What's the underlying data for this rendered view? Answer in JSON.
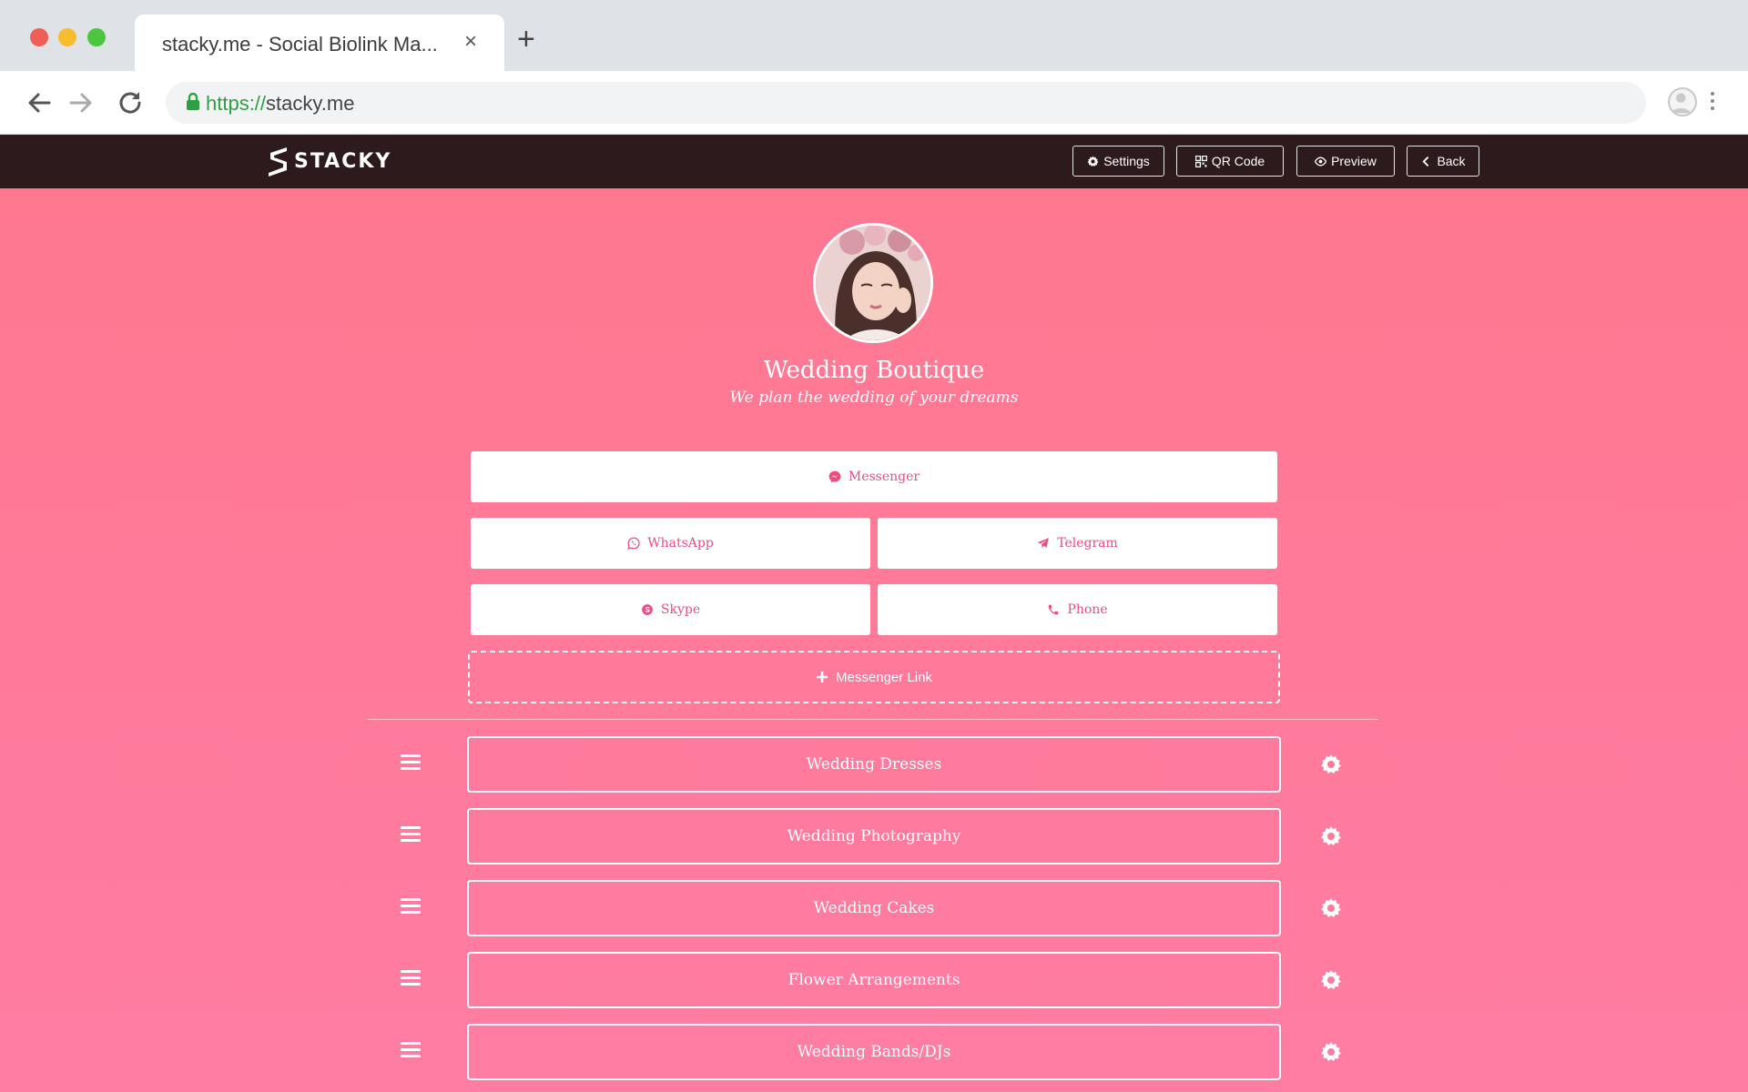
{
  "browser": {
    "tab_title": "stacky.me - Social Biolink Ma...",
    "tab_close": "×",
    "new_tab": "+",
    "url_scheme": "https://",
    "url_host": "stacky.me"
  },
  "app": {
    "logo_text": "STACKY",
    "header_buttons": {
      "settings": "Settings",
      "qr_code": "QR Code",
      "preview": "Preview",
      "back": "Back"
    }
  },
  "profile": {
    "name": "Wedding Boutique",
    "tagline": "We plan the wedding of your dreams"
  },
  "messengers": {
    "messenger": "Messenger",
    "whatsapp": "WhatsApp",
    "telegram": "Telegram",
    "skype": "Skype",
    "phone": "Phone",
    "add_link": "Messenger Link"
  },
  "links": [
    {
      "label": "Wedding Dresses"
    },
    {
      "label": "Wedding Photography"
    },
    {
      "label": "Wedding Cakes"
    },
    {
      "label": "Flower Arrangements"
    },
    {
      "label": "Wedding Bands/DJs"
    }
  ],
  "colors": {
    "header_bg": "#2c1a1d",
    "page_gradient_top": "#ff7890",
    "page_gradient_bottom": "#ff7ca3",
    "accent_text": "#e84f7e"
  }
}
